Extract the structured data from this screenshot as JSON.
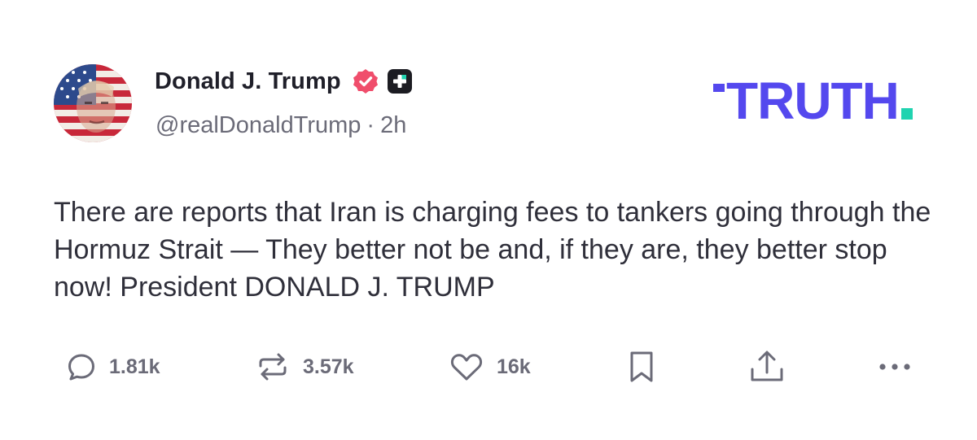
{
  "author": {
    "display_name": "Donald J. Trump",
    "handle": "@realDonaldTrump",
    "separator": "·",
    "timestamp": "2h",
    "avatar_icon": "american-flag-portrait-avatar",
    "verified_icon": "verified-badge-icon",
    "badge_icon": "plus-badge-icon"
  },
  "brand": {
    "name": "TRUTH",
    "primary_color": "#5448ee",
    "accent_color": "#20d3b0"
  },
  "post": {
    "text": "There are reports that Iran is charging fees to tankers going through the Hormuz Strait — They better not be and, if they are, they better stop now! President DONALD J. TRUMP"
  },
  "actions": {
    "reply": {
      "icon": "reply-icon",
      "count": "1.81k"
    },
    "retruth": {
      "icon": "retruth-icon",
      "count": "3.57k"
    },
    "like": {
      "icon": "heart-icon",
      "count": "16k"
    },
    "bookmark": {
      "icon": "bookmark-icon"
    },
    "share": {
      "icon": "share-icon"
    },
    "more": {
      "icon": "more-icon"
    }
  },
  "colors": {
    "text": "#2f2f3a",
    "muted": "#6b6b78",
    "verified": "#f04e6c"
  }
}
